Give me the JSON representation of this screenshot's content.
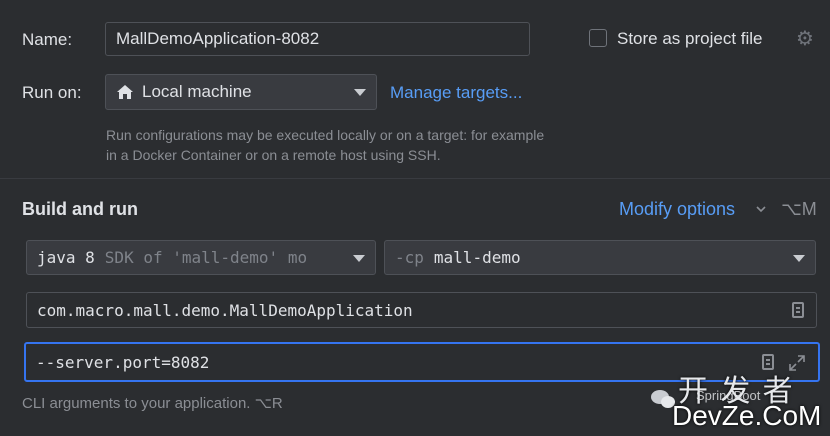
{
  "name": {
    "label": "Name:",
    "value": "MallDemoApplication-8082"
  },
  "store_as_project_file": {
    "label": "Store as project file",
    "checked": false
  },
  "run_on": {
    "label": "Run on:",
    "value": "Local machine",
    "manage_link": "Manage targets..."
  },
  "run_on_hint": {
    "line1": "Run configurations may be executed locally or on a target: for example",
    "line2": "in a Docker Container or on a remote host using SSH."
  },
  "build_and_run": {
    "title": "Build and run",
    "modify_options": "Modify options",
    "shortcut": "⌥M"
  },
  "jre": {
    "version": "java 8",
    "detail": "SDK of 'mall-demo' mo"
  },
  "classpath": {
    "prefix": "-cp",
    "module": "mall-demo"
  },
  "main_class": {
    "value": "com.macro.mall.demo.MallDemoApplication"
  },
  "program_args": {
    "value": "--server.port=8082"
  },
  "program_args_hint": "CLI arguments to your application. ⌥R",
  "watermark": {
    "text1": "开 发 者",
    "text2": "DevZe.CoM",
    "text3": "SpringBoot"
  },
  "colors": {
    "background": "#2b2d30",
    "accent": "#589df6",
    "focus": "#3574f0"
  }
}
